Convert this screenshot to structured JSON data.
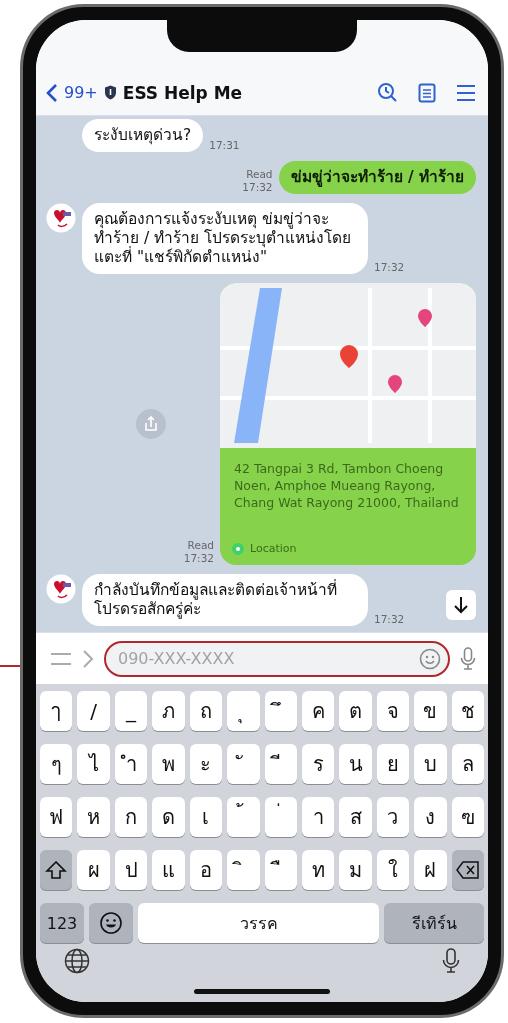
{
  "header": {
    "back_count": "99+",
    "title": "ESS Help Me"
  },
  "messages": [
    {
      "kind": "received",
      "avatar": false,
      "text": "ระงับเหตุด่วน?",
      "time": "17:31"
    },
    {
      "kind": "sent",
      "text": "ข่มขู่ว่าจะทำร้าย / ทำร้าย",
      "read": "Read",
      "time": "17:32"
    },
    {
      "kind": "received",
      "avatar": true,
      "text": "คุณต้องการแจ้งระงับเหตุ ข่มขู่ว่าจะทำร้าย / ทำร้าย โปรดระบุตำแหน่งโดยแตะที่ \"แชร์พิกัดตำแหน่ง\"",
      "time": "17:32"
    },
    {
      "kind": "location",
      "address": "42 Tangpai 3 Rd, Tambon Choeng Noen, Amphoe Mueang Rayong, Chang Wat Rayong 21000, Thailand",
      "label": "Location",
      "read": "Read",
      "time": "17:32"
    },
    {
      "kind": "received",
      "avatar": true,
      "text": "กำลังบันทึกข้อมูลและติดต่อเจ้าหน้าที่โปรดรอสักครู่ค่ะ",
      "time": "17:32"
    }
  ],
  "input": {
    "placeholder": "090-XXX-XXXX"
  },
  "keyboard": {
    "rows": [
      [
        "ๅ",
        "/",
        "_",
        "ภ",
        "ถ",
        "ุ",
        "ึ",
        "ค",
        "ต",
        "จ",
        "ข",
        "ช"
      ],
      [
        "ๆ",
        "ไ",
        "ำ",
        "พ",
        "ะ",
        "ั",
        "ี",
        "ร",
        "น",
        "ย",
        "บ",
        "ล"
      ],
      [
        "ฟ",
        "ห",
        "ก",
        "ด",
        "เ",
        "้",
        "่",
        "า",
        "ส",
        "ว",
        "ง",
        "ฃ"
      ],
      [
        {
          "kind": "shift"
        },
        {
          "kind": "letter",
          "label": "ผ"
        },
        {
          "kind": "letter",
          "label": "ป"
        },
        {
          "kind": "letter",
          "label": "แ"
        },
        {
          "kind": "letter",
          "label": "อ"
        },
        {
          "kind": "letter",
          "label": "ิ"
        },
        {
          "kind": "letter",
          "label": "ื"
        },
        {
          "kind": "letter",
          "label": "ท"
        },
        {
          "kind": "letter",
          "label": "ม"
        },
        {
          "kind": "letter",
          "label": "ใ"
        },
        {
          "kind": "letter",
          "label": "ฝ"
        },
        {
          "kind": "delete"
        }
      ]
    ],
    "numbers": "123",
    "space": "วรรค",
    "return": "รีเทิร์น"
  }
}
